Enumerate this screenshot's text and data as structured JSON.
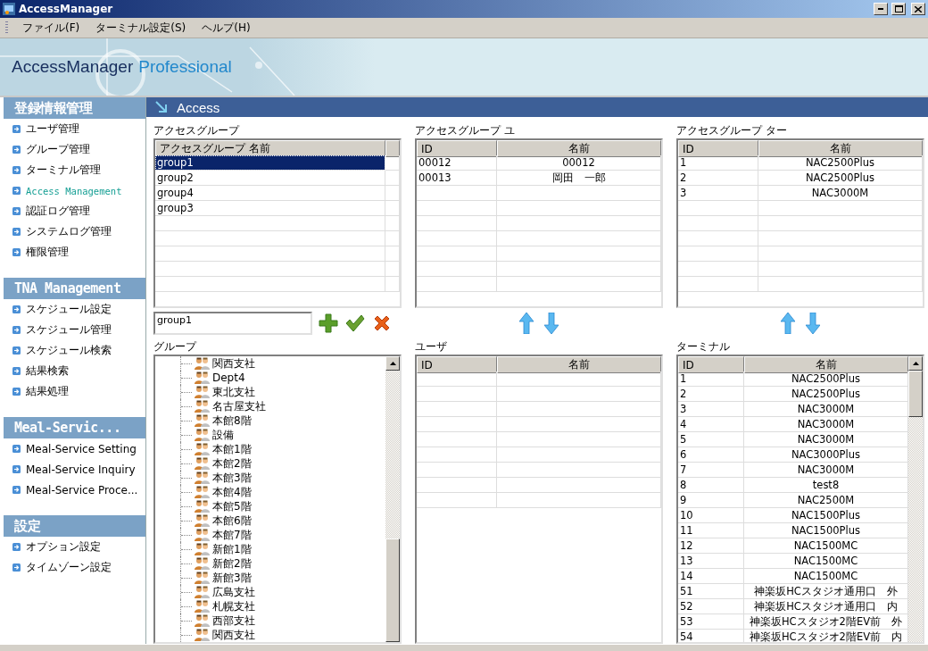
{
  "window": {
    "title": "AccessManager"
  },
  "menu": [
    "ファイル(F)",
    "ターミナル設定(S)",
    "ヘルプ(H)"
  ],
  "banner": {
    "title": "AccessManager",
    "subtitle": "Professional"
  },
  "sidebar": [
    {
      "title": "登録情報管理",
      "items": [
        {
          "label": "ユーザ管理",
          "selected": false
        },
        {
          "label": "グループ管理",
          "selected": false
        },
        {
          "label": "ターミナル管理",
          "selected": false
        },
        {
          "label": "Access Management",
          "selected": true
        },
        {
          "label": "認証ログ管理",
          "selected": false
        },
        {
          "label": "システムログ管理",
          "selected": false
        },
        {
          "label": "権限管理",
          "selected": false
        }
      ]
    },
    {
      "title": "TNA Management",
      "items": [
        {
          "label": "スケジュール設定",
          "selected": false
        },
        {
          "label": "スケジュール管理",
          "selected": false
        },
        {
          "label": "スケジュール検索",
          "selected": false
        },
        {
          "label": "結果検索",
          "selected": false
        },
        {
          "label": "結果処理",
          "selected": false
        }
      ]
    },
    {
      "title": "Meal-Servic...",
      "items": [
        {
          "label": "Meal-Service Setting",
          "selected": false
        },
        {
          "label": "Meal-Service Inquiry",
          "selected": false
        },
        {
          "label": "Meal-Service Proce...",
          "selected": false
        }
      ]
    },
    {
      "title": "設定",
      "items": [
        {
          "label": "オプション設定",
          "selected": false
        },
        {
          "label": "タイムゾーン設定",
          "selected": false
        }
      ]
    }
  ],
  "page_title": "Access",
  "access_groups": {
    "label": "アクセスグループ",
    "column": "アクセスグループ 名前",
    "rows": [
      {
        "name": "group1",
        "selected": true
      },
      {
        "name": "group2",
        "selected": false
      },
      {
        "name": "group4",
        "selected": false
      },
      {
        "name": "group3",
        "selected": false
      }
    ],
    "name_input": {
      "value": "group1"
    }
  },
  "access_group_users": {
    "label": "アクセスグループ ユ",
    "columns": [
      "ID",
      "名前"
    ],
    "rows": [
      {
        "id": "00012",
        "name": "00012"
      },
      {
        "id": "00013",
        "name": "岡田　一郎"
      }
    ]
  },
  "access_group_terminals": {
    "label": "アクセスグループ ター",
    "columns": [
      "ID",
      "名前"
    ],
    "rows": [
      {
        "id": "1",
        "name": "NAC2500Plus"
      },
      {
        "id": "2",
        "name": "NAC2500Plus"
      },
      {
        "id": "3",
        "name": "NAC3000M"
      }
    ]
  },
  "groups": {
    "label": "グループ",
    "items": [
      "関西支社",
      "Dept4",
      "東北支社",
      "名古屋支社",
      "本館8階",
      "設備",
      "本館1階",
      "本館2階",
      "本館3階",
      "本館4階",
      "本館5階",
      "本館6階",
      "本館7階",
      "新館1階",
      "新館2階",
      "新館3階",
      "広島支社",
      "札幌支社",
      "西部支社",
      "関西支社"
    ]
  },
  "users": {
    "label": "ユーザ",
    "columns": [
      "ID",
      "名前"
    ]
  },
  "terminals": {
    "label": "ターミナル",
    "columns": [
      "ID",
      "名前"
    ],
    "rows": [
      {
        "id": "1",
        "name": "NAC2500Plus"
      },
      {
        "id": "2",
        "name": "NAC2500Plus"
      },
      {
        "id": "3",
        "name": "NAC3000M"
      },
      {
        "id": "4",
        "name": "NAC3000M"
      },
      {
        "id": "5",
        "name": "NAC3000M"
      },
      {
        "id": "6",
        "name": "NAC3000Plus"
      },
      {
        "id": "7",
        "name": "NAC3000M"
      },
      {
        "id": "8",
        "name": "test8"
      },
      {
        "id": "9",
        "name": "NAC2500M"
      },
      {
        "id": "10",
        "name": "NAC1500Plus"
      },
      {
        "id": "11",
        "name": "NAC1500Plus"
      },
      {
        "id": "12",
        "name": "NAC1500MC"
      },
      {
        "id": "13",
        "name": "NAC1500MC"
      },
      {
        "id": "14",
        "name": "NAC1500MC"
      },
      {
        "id": "51",
        "name": "神楽坂HCスタジオ通用口　外"
      },
      {
        "id": "52",
        "name": "神楽坂HCスタジオ通用口　内"
      },
      {
        "id": "53",
        "name": "神楽坂HCスタジオ2階EV前　外"
      },
      {
        "id": "54",
        "name": "神楽坂HCスタジオ2階EV前　内"
      }
    ]
  }
}
